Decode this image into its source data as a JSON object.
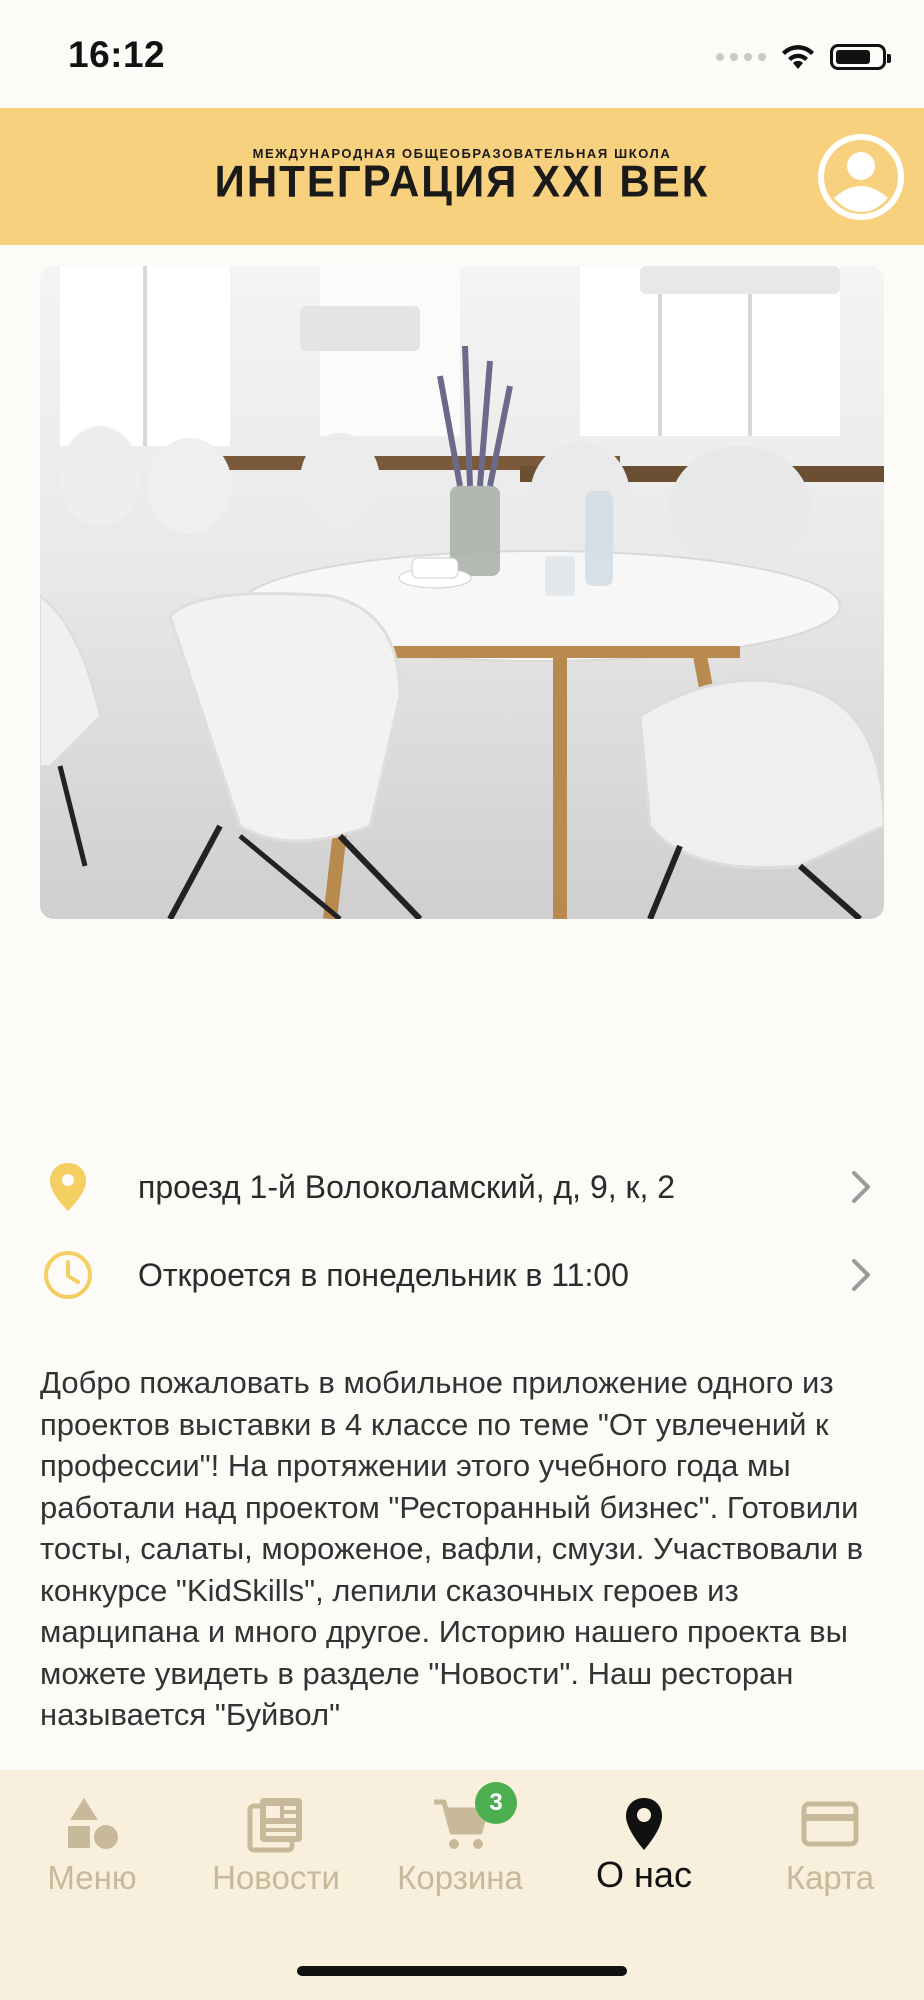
{
  "status_bar": {
    "time": "16:12"
  },
  "header": {
    "logo_top": "МЕЖДУНАРОДНАЯ  ОБЩЕОБРАЗОВАТЕЛЬНАЯ  ШКОЛА",
    "logo_main": "ИНТЕГРАЦИЯ XXI ВЕК",
    "profile_icon": "user-circle-icon"
  },
  "hero": {
    "alt_icon": "cafe-photo"
  },
  "info": {
    "address": "проезд 1-й Волоколамский, д, 9, к, 2",
    "hours": "Откроется в понедельник в 11:00"
  },
  "description": "Добро пожаловать в мобильное приложение одного из проектов выставки в 4 классе по теме \"От увлечений к профессии\"! На протяжении этого учебного года мы работали над проектом \"Ресторанный бизнес\". Готовили тосты, салаты, мороженое, вафли, смузи. Участвовали в конкурсе \"KidSkills\", лепили сказочных героев из марципана и много другое. Историю нашего проекта вы можете увидеть в разделе \"Новости\". Наш ресторан называется \"Буйвол\"",
  "tabbar": {
    "items": [
      {
        "label": "Меню",
        "icon": "shapes-icon"
      },
      {
        "label": "Новости",
        "icon": "news-icon"
      },
      {
        "label": "Корзина",
        "icon": "cart-icon",
        "badge": "3"
      },
      {
        "label": "О нас",
        "icon": "location-pin-icon",
        "active": true
      },
      {
        "label": "Карта",
        "icon": "credit-card-icon"
      }
    ]
  },
  "colors": {
    "header": "#f8d17e",
    "accent": "#f5cf62",
    "tabbar": "#f8f0dc",
    "tab_inactive": "#c8b99a",
    "badge": "#4caf50"
  }
}
